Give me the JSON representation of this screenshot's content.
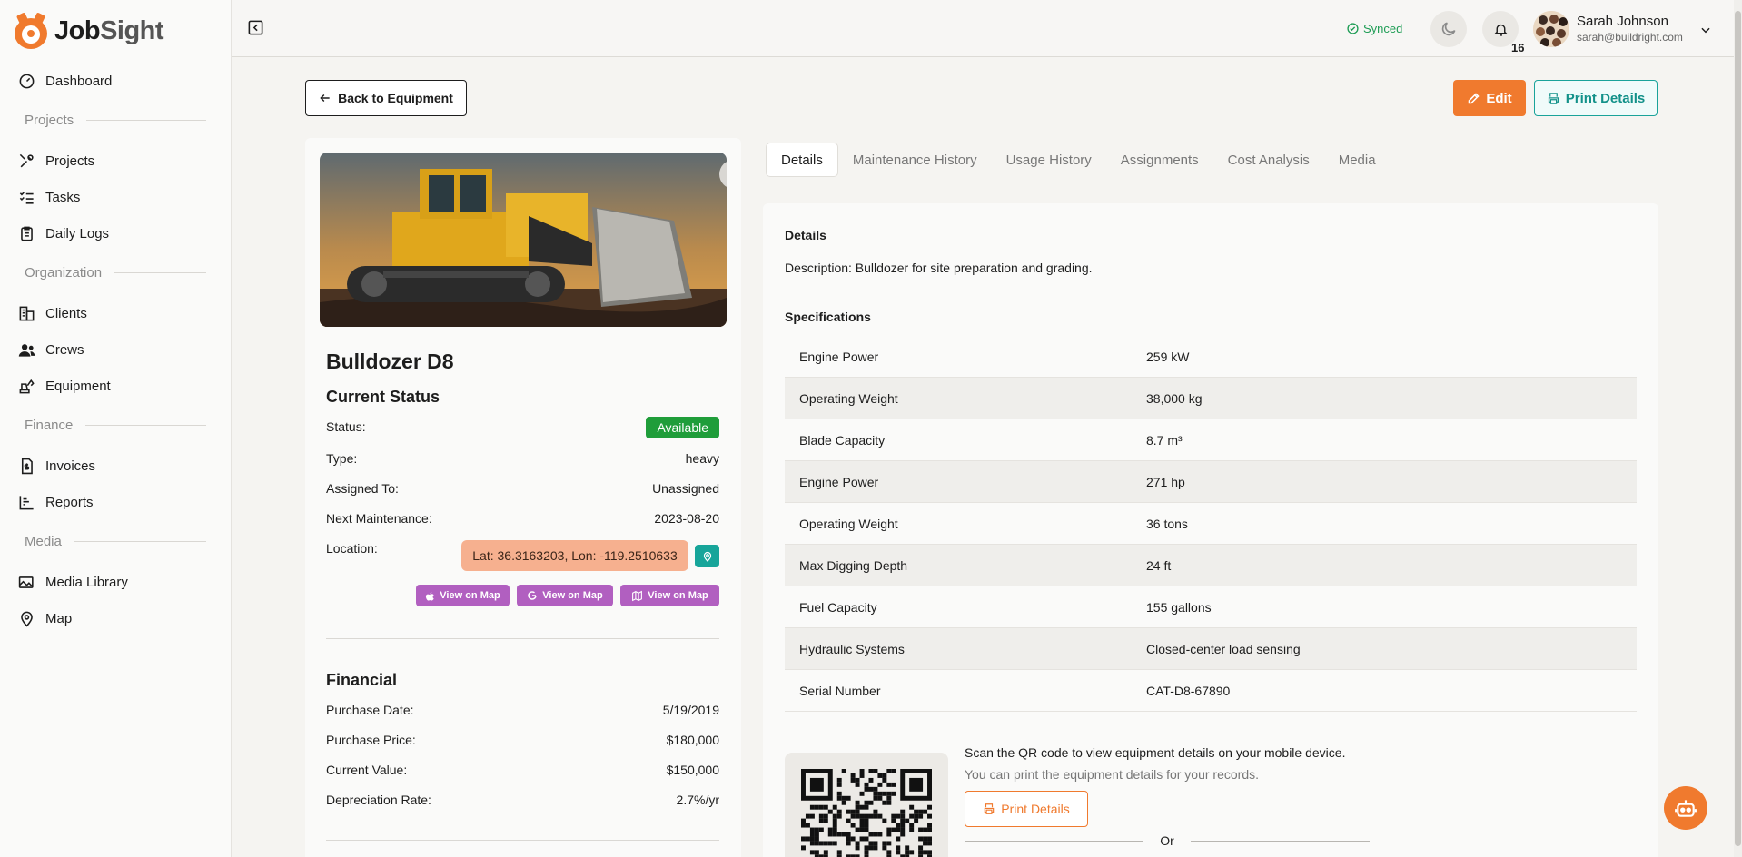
{
  "brand": {
    "name_part1": "Job",
    "name_part2": "Sight",
    "accent": "#f07a2e"
  },
  "sidebar": {
    "items": [
      {
        "label": "Dashboard",
        "icon": "gauge-icon"
      },
      {
        "label": "Projects",
        "icon": "tools-icon"
      },
      {
        "label": "Tasks",
        "icon": "checklist-icon"
      },
      {
        "label": "Daily Logs",
        "icon": "clipboard-icon"
      },
      {
        "label": "Clients",
        "icon": "building-icon"
      },
      {
        "label": "Crews",
        "icon": "users-icon"
      },
      {
        "label": "Equipment",
        "icon": "excavator-icon"
      },
      {
        "label": "Invoices",
        "icon": "invoice-icon"
      },
      {
        "label": "Reports",
        "icon": "chart-icon"
      },
      {
        "label": "Media Library",
        "icon": "image-icon"
      },
      {
        "label": "Map",
        "icon": "map-pin-icon"
      }
    ],
    "sections": [
      "Projects",
      "Organization",
      "Finance",
      "Media"
    ]
  },
  "topbar": {
    "sync_status": "Synced",
    "notification_count": "16",
    "user_name": "Sarah Johnson",
    "user_email": "sarah@buildright.com"
  },
  "actions": {
    "back": "Back to Equipment",
    "edit": "Edit",
    "print": "Print Details"
  },
  "equipment": {
    "name": "Bulldozer D8",
    "current_status_title": "Current Status",
    "status_label": "Status:",
    "status_value": "Available",
    "type_label": "Type:",
    "type_value": "heavy",
    "assigned_label": "Assigned To:",
    "assigned_value": "Unassigned",
    "next_maint_label": "Next Maintenance:",
    "next_maint_value": "2023-08-20",
    "location_label": "Location:",
    "location_value": "Lat: 36.3163203, Lon: -119.2510633",
    "map_buttons": [
      "View on Map",
      "View on Map",
      "View on Map"
    ],
    "financial_title": "Financial",
    "purchase_date_label": "Purchase Date:",
    "purchase_date_value": "5/19/2019",
    "purchase_price_label": "Purchase Price:",
    "purchase_price_value": "$180,000",
    "current_value_label": "Current Value:",
    "current_value_value": "$150,000",
    "depreciation_label": "Depreciation Rate:",
    "depreciation_value": "2.7%/yr"
  },
  "tabs": [
    "Details",
    "Maintenance History",
    "Usage History",
    "Assignments",
    "Cost Analysis",
    "Media"
  ],
  "details": {
    "heading": "Details",
    "description": "Description: Bulldozer for site preparation and grading.",
    "specs_heading": "Specifications",
    "specs": [
      [
        "Engine Power",
        "259 kW"
      ],
      [
        "Operating Weight",
        "38,000 kg"
      ],
      [
        "Blade Capacity",
        "8.7 m³"
      ],
      [
        "Engine Power",
        "271 hp"
      ],
      [
        "Operating Weight",
        "36 tons"
      ],
      [
        "Max Digging Depth",
        "24 ft"
      ],
      [
        "Fuel Capacity",
        "155 gallons"
      ],
      [
        "Hydraulic Systems",
        "Closed-center load sensing"
      ],
      [
        "Serial Number",
        "CAT-D8-67890"
      ]
    ],
    "qr_text1": "Scan the QR code to view equipment details on your mobile device.",
    "qr_text2": "You can print the equipment details for your records.",
    "qr_print": "Print Details",
    "or": "Or"
  }
}
